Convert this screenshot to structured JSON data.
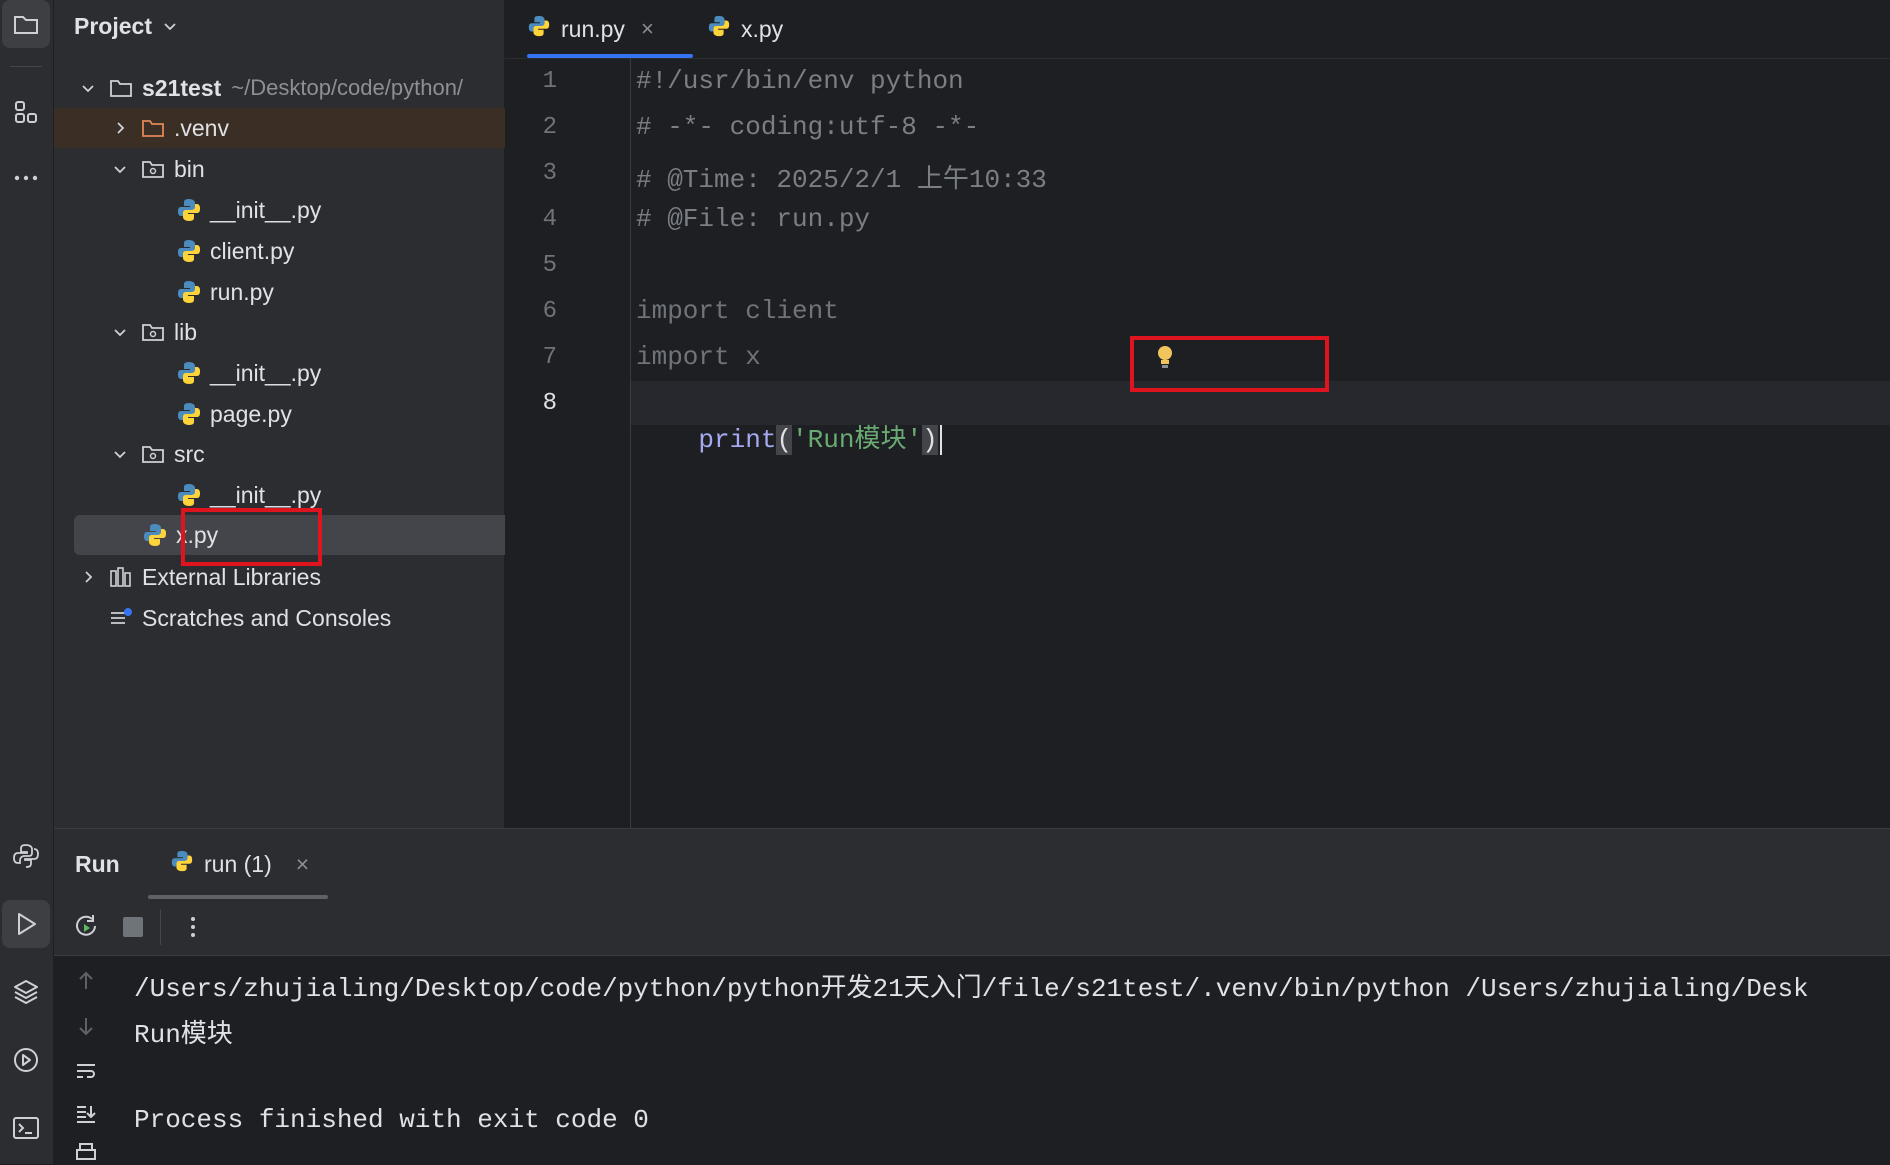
{
  "project": {
    "title": "Project",
    "root": {
      "name": "s21test",
      "hint": "~/Desktop/code/python/"
    },
    "items": [
      {
        "label": ".venv"
      },
      {
        "label": "bin"
      },
      {
        "label": "__init__.py"
      },
      {
        "label": "client.py"
      },
      {
        "label": "run.py"
      },
      {
        "label": "lib"
      },
      {
        "label": "__init__.py"
      },
      {
        "label": "page.py"
      },
      {
        "label": "src"
      },
      {
        "label": "__init__.py"
      },
      {
        "label": "x.py"
      },
      {
        "label": "External Libraries"
      },
      {
        "label": "Scratches and Consoles"
      }
    ]
  },
  "editor": {
    "tabs": [
      {
        "label": "run.py",
        "active": true
      },
      {
        "label": "x.py",
        "active": false
      }
    ],
    "tab_close": "×",
    "line_numbers": [
      "1",
      "2",
      "3",
      "4",
      "5",
      "6",
      "7",
      "8"
    ],
    "lines": {
      "l1": "#!/usr/bin/env python",
      "l2": "# -*- coding:utf-8 -*-",
      "l3": "# @Time: 2025/2/1 上午10:33",
      "l4": "# @File: run.py",
      "l6": "import client",
      "l7": "import x",
      "l8_fn": "print",
      "l8_open": "(",
      "l8_str": "'Run模块'",
      "l8_close": ")"
    }
  },
  "run": {
    "title": "Run",
    "tab_label": "run (1)",
    "tab_close": "×",
    "console": {
      "line1": "/Users/zhujialing/Desktop/code/python/python开发21天入门/file/s21test/.venv/bin/python /Users/zhujialing/Desk",
      "line2": "Run模块",
      "line3": "",
      "line4": "Process finished with exit code 0"
    }
  },
  "colors": {
    "accent": "#3574f0",
    "highlight": "#e0141e",
    "keyword": "#a4a9f0",
    "string": "#6aab73",
    "python_blue": "#4b8bbe",
    "python_yellow": "#ffd43b"
  }
}
